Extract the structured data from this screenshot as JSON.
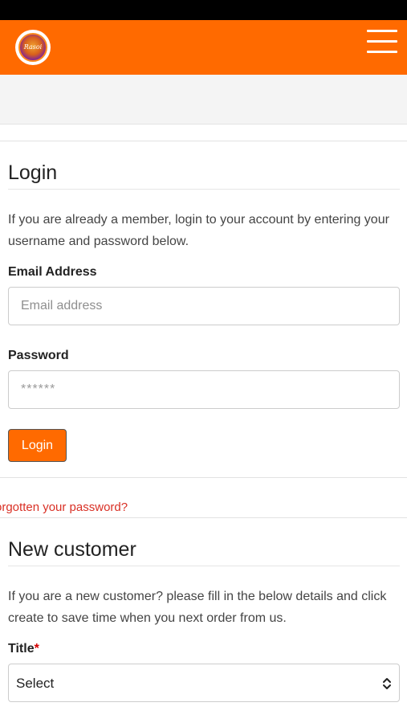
{
  "header": {
    "logo_text": "Rasoi",
    "brand_color": "#ff6a00"
  },
  "login": {
    "title": "Login",
    "intro": "If you are already a member, login to your account by entering your username and password below.",
    "email_label": "Email Address",
    "email_placeholder": "Email address",
    "password_label": "Password",
    "password_placeholder": "******",
    "button_label": "Login",
    "forgot_link": "orgotten your password?"
  },
  "new_customer": {
    "title": "New customer",
    "intro": "If you are a new customer? please fill in the below details and click create to save time when you next order from us.",
    "title_label": "Title",
    "required_marker": "*",
    "title_select_value": "Select"
  },
  "icons": {
    "menu": "hamburger-menu-icon",
    "select": "up-down-chevron-icon"
  }
}
